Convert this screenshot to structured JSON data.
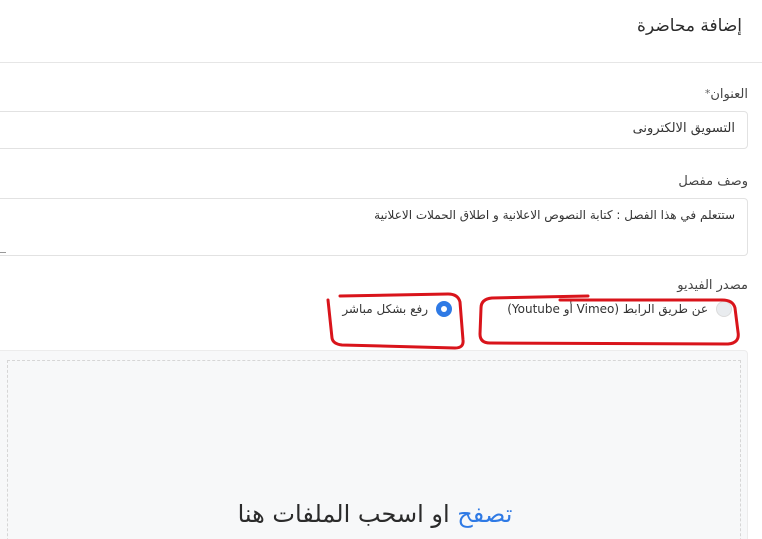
{
  "modal": {
    "title": "إضافة محاضرة"
  },
  "form": {
    "title_field": {
      "label": "العنوان",
      "required_mark": "*",
      "value": "التسويق الالكترونى"
    },
    "description_field": {
      "label": "وصف مفصل",
      "value": "ستتعلم في هذا الفصل : كتابة النصوص الاعلانية و اطلاق الحملات الاعلانية"
    },
    "video_source": {
      "label": "مصدر الفيديو",
      "options": [
        {
          "label": "عن طريق الرابط (Vimeo أو Youtube)",
          "selected": false
        },
        {
          "label": "رفع بشكل مباشر",
          "selected": true
        }
      ]
    },
    "dropzone": {
      "browse_label": "تصفح",
      "rest_label": " او اسحب الملفات هنا"
    }
  },
  "colors": {
    "accent": "#2f7ae5",
    "annotation": "#d9141b"
  },
  "icons": [
    "radio-unselected-icon",
    "radio-selected-icon",
    "textarea-resize-icon"
  ]
}
